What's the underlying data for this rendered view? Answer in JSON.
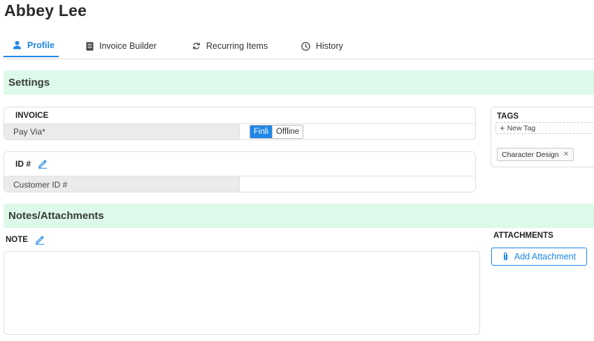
{
  "page": {
    "title": "Abbey Lee"
  },
  "tabs": [
    {
      "label": "Profile",
      "icon": "user-icon",
      "active": true
    },
    {
      "label": "Invoice Builder",
      "icon": "receipt-icon",
      "active": false
    },
    {
      "label": "Recurring Items",
      "icon": "refresh-icon",
      "active": false
    },
    {
      "label": "History",
      "icon": "clock-icon",
      "active": false
    }
  ],
  "settings": {
    "heading": "Settings",
    "invoice": {
      "heading": "INVOICE",
      "pay_via_label": "Pay Via*",
      "options": [
        "Finli",
        "Offline"
      ],
      "selected": "Finli"
    },
    "id": {
      "heading": "ID #",
      "customer_id_label": "Customer ID #",
      "customer_id_value": ""
    },
    "tags": {
      "heading": "TAGS",
      "new_tag_label": "New Tag",
      "items": [
        "Character Design"
      ]
    }
  },
  "notes": {
    "heading": "Notes/Attachments",
    "note_label": "NOTE",
    "note_value": "",
    "attachments_label": "ATTACHMENTS",
    "add_attachment_label": "Add Attachment"
  },
  "colors": {
    "accent": "#1e86e6",
    "banner_bg": "#dcf9ea",
    "label_bg": "#ebebeb"
  }
}
